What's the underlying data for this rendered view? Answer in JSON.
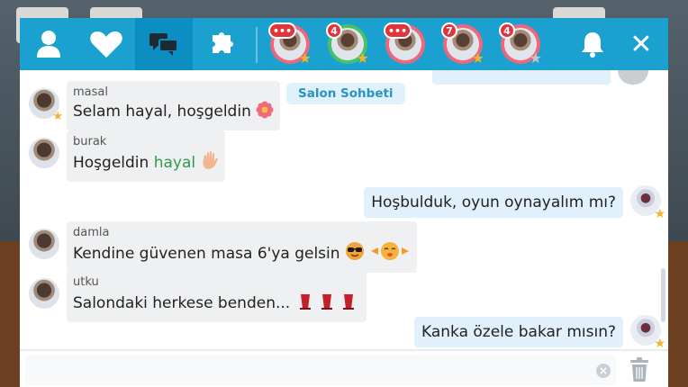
{
  "tabs": [
    {
      "icon": "user-icon"
    },
    {
      "icon": "heart-icon"
    },
    {
      "icon": "chat-bubbles-icon",
      "active": true
    },
    {
      "icon": "puzzle-icon"
    }
  ],
  "top_avatars": [
    {
      "badge": "•••",
      "star": "gold",
      "ring": "pink"
    },
    {
      "badge": "4",
      "star": "gold",
      "ring": "green"
    },
    {
      "badge": "•••",
      "star": "",
      "ring": "pink"
    },
    {
      "badge": "7",
      "star": "gold",
      "ring": "pink"
    },
    {
      "badge": "4",
      "star": "grey",
      "ring": "pink"
    }
  ],
  "chat": {
    "room_label": "Salon Sohbeti",
    "messages": [
      {
        "name": "masal",
        "text": "Selam hayal, hoşgeldin"
      },
      {
        "name": "burak",
        "text_before": "Hoşgeldin ",
        "text_highlight": "hayal"
      },
      {
        "own": true,
        "text": "Hoşbulduk, oyun oynayalım mı?"
      },
      {
        "name": "damla",
        "text": "Kendine güvenen masa 6'ya gelsin"
      },
      {
        "name": "utku",
        "text": "Salondaki herkese benden..."
      },
      {
        "own": true,
        "text": "Kanka özele bakar mısın?"
      }
    ]
  },
  "input": {
    "value": "",
    "placeholder": ""
  },
  "colors": {
    "header": "#1aa1d0",
    "active_tab": "#0d8ec2",
    "own_bubble": "#e0f1fb",
    "other_bubble": "#eef0f2",
    "badge": "#e2343f",
    "highlight": "#2c9c4a"
  }
}
